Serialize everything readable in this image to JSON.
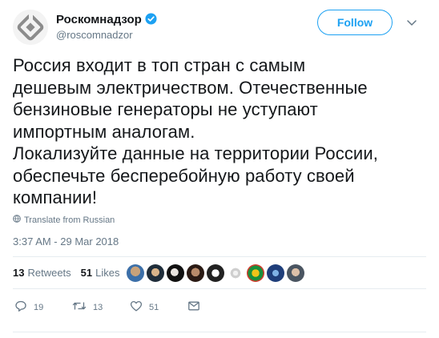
{
  "author": {
    "name": "Роскомнадзор",
    "handle": "@roscomnadzor"
  },
  "follow_label": "Follow",
  "tweet_lines": [
    "Россия входит в топ стран с самым",
    "дешевым электричеством. Отечественные",
    "бензиновые генераторы не уступают",
    "импортным аналогам.",
    "Локализуйте данные на территории России,",
    "обеспечьте бесперебойную работу своей",
    "компании!"
  ],
  "translate_label": "Translate from Russian",
  "timestamp": "3:37 AM - 29 Mar 2018",
  "stats": {
    "retweets_count": "13",
    "retweets_label": "Retweets",
    "likes_count": "51",
    "likes_label": "Likes"
  },
  "actions": {
    "replies": "19",
    "retweets": "13",
    "likes": "51"
  },
  "colors": {
    "accent": "#1da1f2",
    "text": "#14171a",
    "muted": "#657786",
    "divider": "#e6ecf0"
  },
  "icons": [
    "roskomnadzor-logo",
    "verified-badge-icon",
    "chevron-down-icon",
    "globe-icon",
    "reply-icon",
    "retweet-icon",
    "like-icon",
    "message-icon"
  ]
}
